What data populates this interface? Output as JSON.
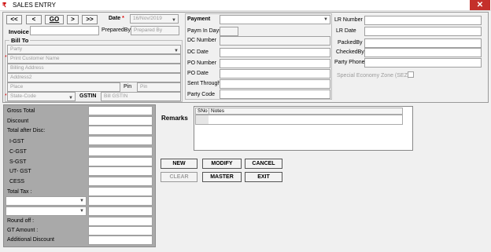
{
  "window": {
    "title": "SALES ENTRY",
    "close_glyph": "✕"
  },
  "nav": {
    "first": "<<",
    "prev": "<",
    "go": "GO",
    "next": ">",
    "last": ">>"
  },
  "header": {
    "invoice_label": "Invoice",
    "date_label": "Date",
    "date_value": "16/Nov/2019",
    "prepared_by_label": "PreparedBy",
    "prepared_by_placeholder": "Prepared By"
  },
  "bill_to": {
    "legend": "Bill To",
    "party_placeholder": "Party",
    "print_name_placeholder": "Print Customer Name",
    "billing_address_placeholder": "Billing Address",
    "address2_placeholder": "Address2",
    "place_placeholder": "Place",
    "pin_label": "Pin",
    "pin_placeholder": "Pin",
    "state_code_placeholder": "State-Code",
    "gstin_label": "GSTIN",
    "gstin_placeholder": "Bill GSTIN"
  },
  "payment": {
    "payment_label": "Payment",
    "paym_in_days_label": "Paym In Days",
    "dc_number_label": "DC Number",
    "dc_date_label": "DC Date",
    "po_number_label": "PO Number",
    "po_date_label": "PO Date",
    "sent_through_label": "Sent Through",
    "party_code_label": "Party Code"
  },
  "lr": {
    "lr_number_label": "LR Number",
    "lr_date_label": "LR Date",
    "packed_by_label": "PackedBy",
    "checked_by_label": "CheckedBy",
    "party_phone_label": "Party Phone",
    "sez_label": "Special Economy Zone (SEZ)"
  },
  "totals": {
    "gross_total": "Gross Total",
    "discount": "Discount",
    "total_after_disc": "Total after Disc:",
    "igst": "I-GST",
    "cgst": "C-GST",
    "sgst": "S-GST",
    "utgst": "UT- GST",
    "cess": "CESS",
    "total_tax": "Total Tax :",
    "round_off": "Round off :",
    "gt_amount": "GT Amount :",
    "additional_discount": "Additional Discount"
  },
  "remarks": {
    "label": "Remarks",
    "col_sno": "SNo",
    "col_notes": "Notes"
  },
  "buttons": {
    "new": "NEW",
    "modify": "MODIFY",
    "cancel": "CANCEL",
    "clear": "CLEAR",
    "master": "MASTER",
    "exit": "EXIT"
  },
  "colors": {
    "close": "#c4302b",
    "totals_panel": "#a9a9a9",
    "required": "#dd0000"
  }
}
